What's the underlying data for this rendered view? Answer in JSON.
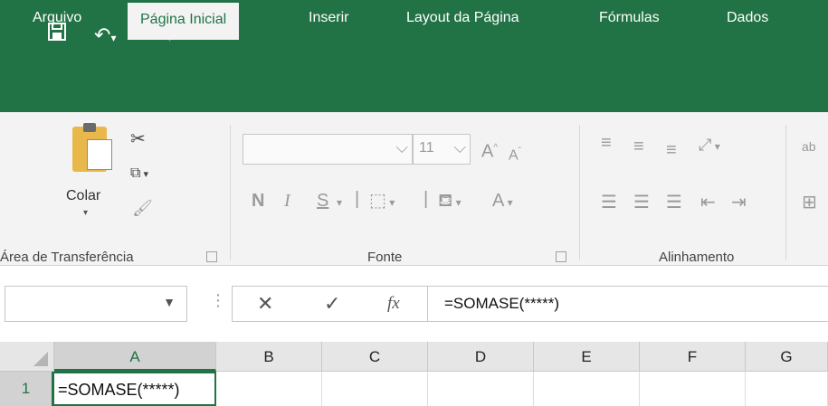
{
  "quick_access": {
    "save_icon": "save-icon",
    "undo_icon": "undo-icon",
    "redo_icon": "redo-icon",
    "customize_icon": "customize-qat-icon"
  },
  "tabs": [
    {
      "label": "Arquivo"
    },
    {
      "label": "Página Inicial"
    },
    {
      "label": "Inserir"
    },
    {
      "label": "Layout da Página"
    },
    {
      "label": "Fórmulas"
    },
    {
      "label": "Dados"
    }
  ],
  "ribbon": {
    "clipboard": {
      "paste_label": "Colar",
      "group_label": "Área de Transferência"
    },
    "font": {
      "name_value": "",
      "size_value": "11",
      "bold": "N",
      "italic": "I",
      "underline": "S",
      "font_color": "A",
      "grow": "A",
      "shrink": "A",
      "group_label": "Fonte"
    },
    "alignment": {
      "group_label": "Alinhamento"
    }
  },
  "formula_bar": {
    "name_box_value": "",
    "fx_label": "fx",
    "formula": "=SOMASE(*****)"
  },
  "grid": {
    "columns": [
      "A",
      "B",
      "C",
      "D",
      "E",
      "F",
      "G"
    ],
    "rows": [
      "1"
    ],
    "a1_value": "=SOMASE(*****)"
  },
  "colors": {
    "accent": "#217346",
    "ribbon_bg": "#f3f3f3"
  }
}
